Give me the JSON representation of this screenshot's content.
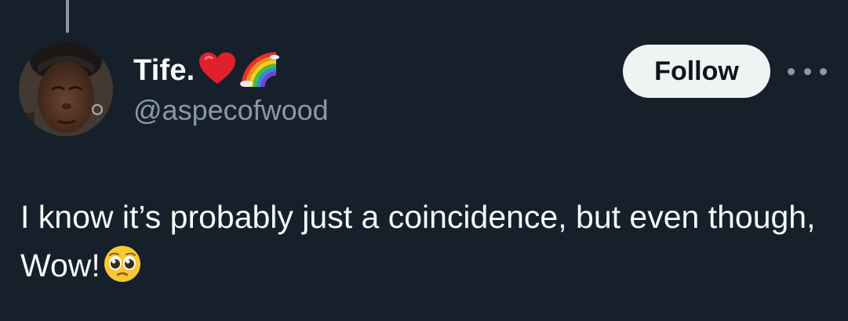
{
  "author": {
    "display_name": "Tife.",
    "handle": "@aspecofwood",
    "name_emojis": [
      "red-heart-icon",
      "rainbow-icon"
    ]
  },
  "actions": {
    "follow_label": "Follow",
    "more_icon": "more-horizontal-icon"
  },
  "tweet": {
    "text": "I know it’s probably just a coincidence, but even though, Wow!",
    "trailing_emoji": "pleading-face-icon"
  },
  "colors": {
    "background": "#15202b",
    "primary_text": "#f7f9f9",
    "secondary_text": "#8b98a5",
    "follow_button_bg": "#eff3f4"
  }
}
